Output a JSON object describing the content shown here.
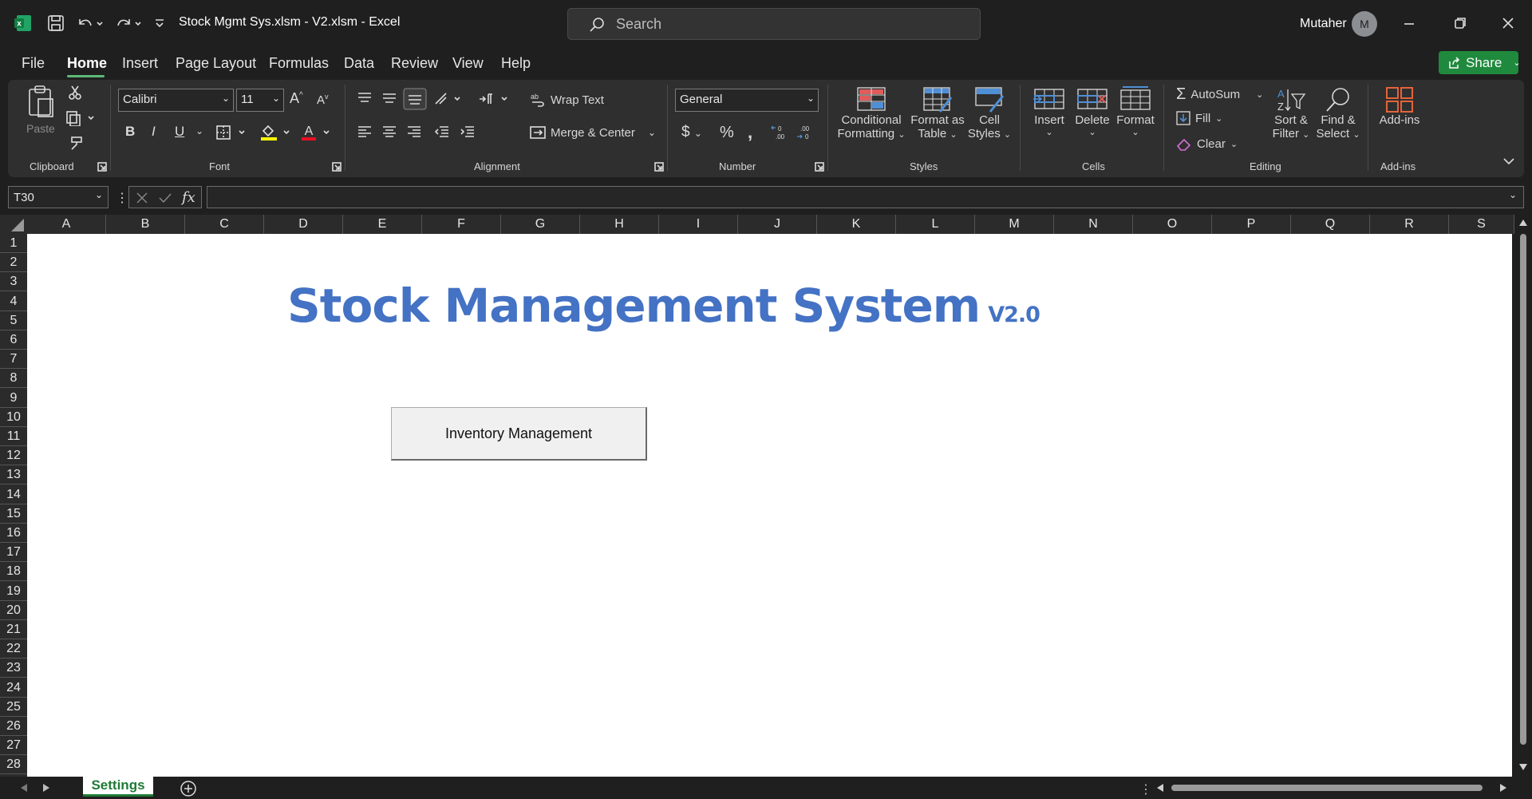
{
  "window": {
    "title": "Stock Mgmt Sys.xlsm - V2.xlsm  -  Excel",
    "user": "Mutaher",
    "avatar_initial": "M"
  },
  "search": {
    "placeholder": "Search"
  },
  "menu": {
    "tabs": [
      "File",
      "Home",
      "Insert",
      "Page Layout",
      "Formulas",
      "Data",
      "Review",
      "View",
      "Help"
    ],
    "share_label": "Share"
  },
  "ribbon": {
    "clipboard": {
      "paste": "Paste",
      "label": "Clipboard"
    },
    "font": {
      "name": "Calibri",
      "size": "11",
      "label": "Font"
    },
    "alignment": {
      "wrap_text": "Wrap Text",
      "merge_center": "Merge & Center",
      "label": "Alignment"
    },
    "number": {
      "format": "General",
      "label": "Number"
    },
    "styles": {
      "conditional_1": "Conditional",
      "conditional_2": "Formatting",
      "format_table_1": "Format as",
      "format_table_2": "Table",
      "cell_styles_1": "Cell",
      "cell_styles_2": "Styles",
      "label": "Styles"
    },
    "cells": {
      "insert": "Insert",
      "delete": "Delete",
      "format": "Format",
      "label": "Cells"
    },
    "editing": {
      "autosum": "AutoSum",
      "fill": "Fill",
      "clear": "Clear",
      "sort_1": "Sort &",
      "sort_2": "Filter",
      "find_1": "Find &",
      "find_2": "Select",
      "label": "Editing"
    },
    "addins": {
      "label_btn": "Add-ins",
      "label": "Add-ins"
    }
  },
  "formula_bar": {
    "cell_ref": "T30",
    "fx": "fx",
    "value": ""
  },
  "grid": {
    "columns": [
      "A",
      "B",
      "C",
      "D",
      "E",
      "F",
      "G",
      "H",
      "I",
      "J",
      "K",
      "L",
      "M",
      "N",
      "O",
      "P",
      "Q",
      "R",
      "S"
    ],
    "rows": [
      "1",
      "2",
      "3",
      "4",
      "5",
      "6",
      "7",
      "8",
      "9",
      "10",
      "11",
      "12",
      "13",
      "14",
      "15",
      "16",
      "17",
      "18",
      "19",
      "20",
      "21",
      "22",
      "23",
      "24",
      "25",
      "26",
      "27",
      "28"
    ]
  },
  "sheet": {
    "title": "Stock Management System",
    "version": "V2.0",
    "button_label": "Inventory Management"
  },
  "sheets": {
    "tabs": [
      "Settings"
    ]
  },
  "colors": {
    "title": "#4472c4",
    "accent": "#1f8a3d",
    "tab_text": "#1e7a36"
  }
}
